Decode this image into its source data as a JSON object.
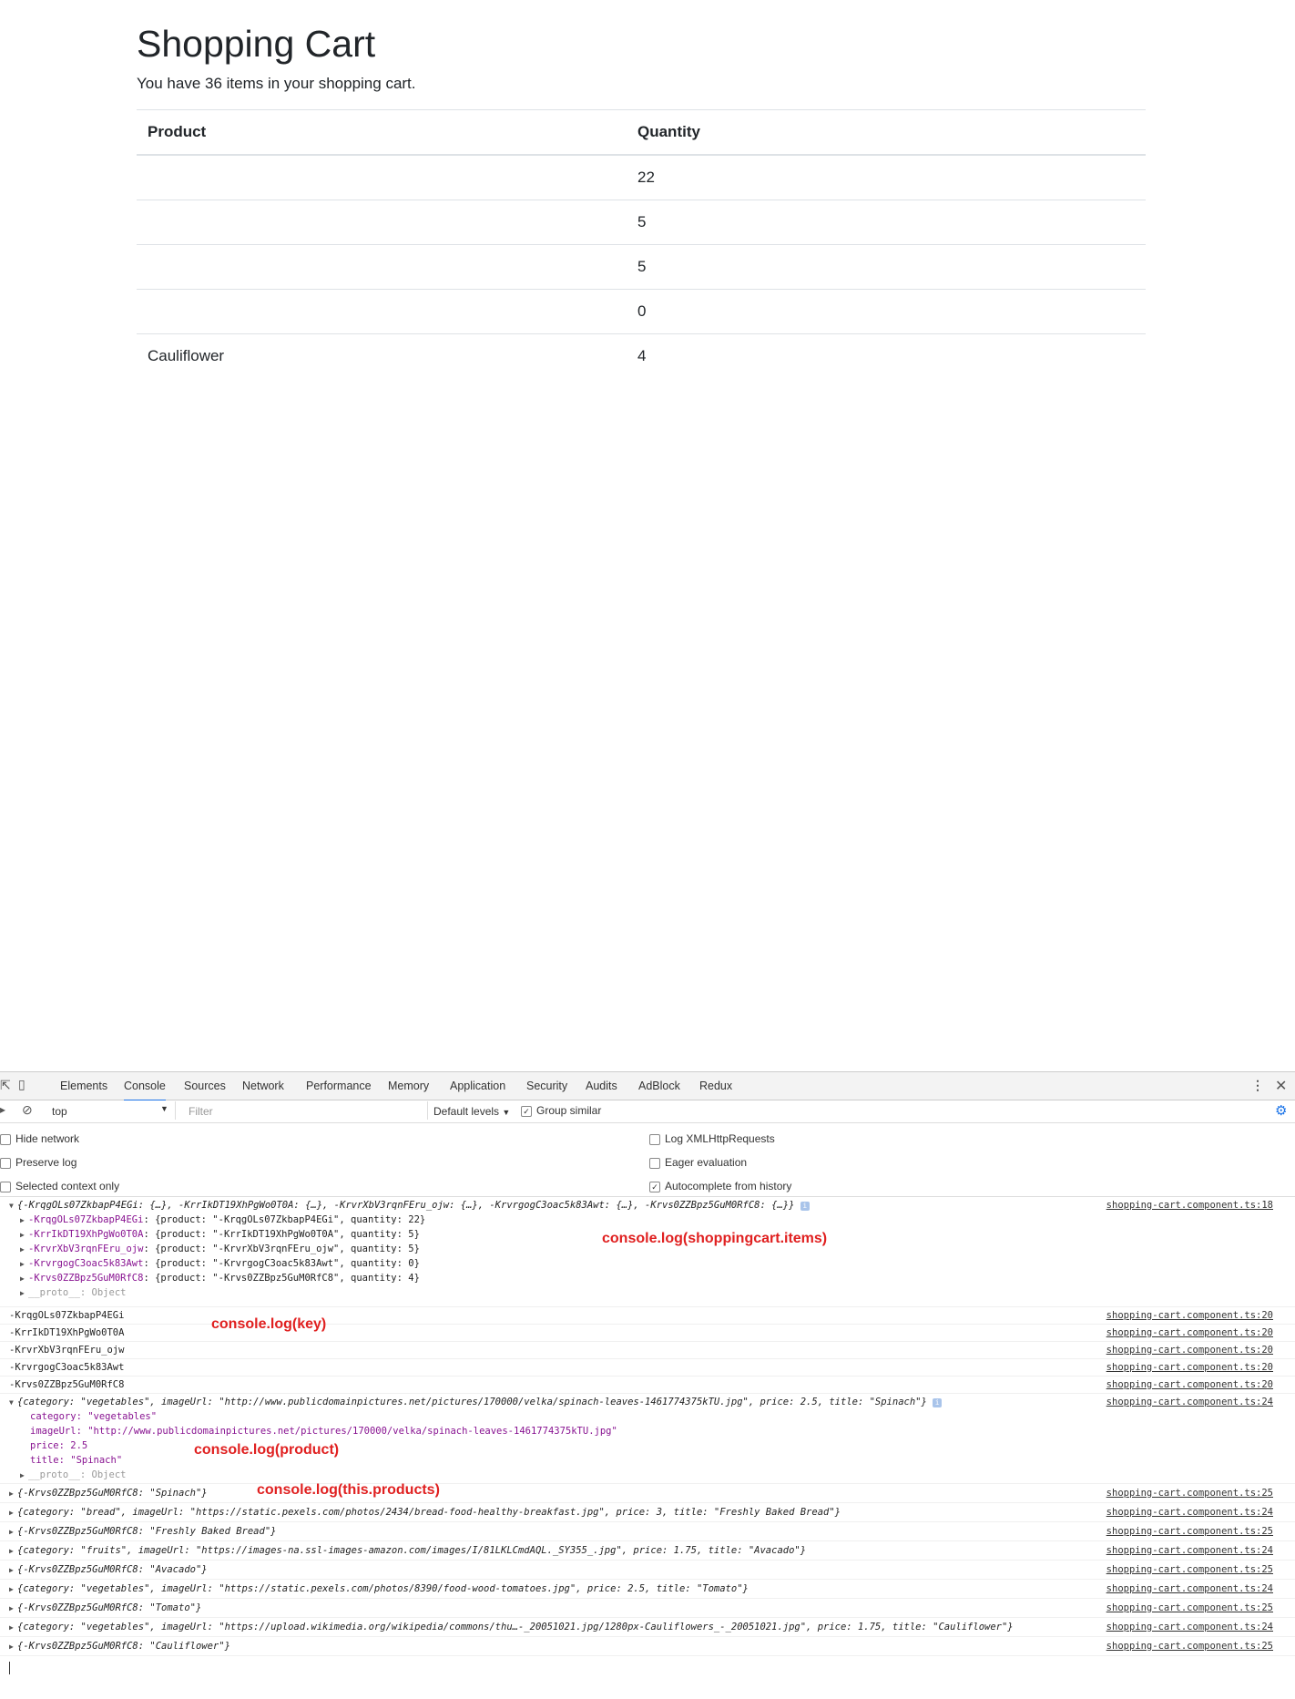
{
  "page": {
    "title": "Shopping Cart",
    "subtitle": "You have 36 items in your shopping cart.",
    "table": {
      "headers": [
        "Product",
        "Quantity"
      ],
      "rows": [
        {
          "product": "",
          "quantity": "22"
        },
        {
          "product": "",
          "quantity": "5"
        },
        {
          "product": "",
          "quantity": "5"
        },
        {
          "product": "",
          "quantity": "0"
        },
        {
          "product": "Cauliflower",
          "quantity": "4"
        }
      ]
    }
  },
  "devtools": {
    "tabs": [
      "Elements",
      "Console",
      "Sources",
      "Network",
      "Performance",
      "Memory",
      "Application",
      "Security",
      "Audits",
      "AdBlock",
      "Redux"
    ],
    "active_tab": "Console",
    "context": "top",
    "filter_placeholder": "Filter",
    "levels": "Default levels",
    "group_similar": "Group similar",
    "options_left": [
      "Hide network",
      "Preserve log",
      "Selected context only"
    ],
    "options_right": [
      "Log XMLHttpRequests",
      "Eager evaluation",
      "Autocomplete from history"
    ],
    "annotations": {
      "items": "console.log(shoppingcart.items)",
      "key": "console.log(key)",
      "product": "console.log(product)",
      "products": "console.log(this.products)"
    },
    "sources": {
      "l18": "shopping-cart.component.ts:18",
      "l20": "shopping-cart.component.ts:20",
      "l24": "shopping-cart.component.ts:24",
      "l25": "shopping-cart.component.ts:25"
    },
    "log": {
      "items_summary": "{-KrqgOLs07ZkbapP4EGi: {…}, -KrrIkDT19XhPgWo0T0A: {…}, -KrvrXbV3rqnFEru_ojw: {…}, -KrvrgogC3oac5k83Awt: {…}, -Krvs0ZZBpz5GuM0RfC8: {…}}",
      "items": [
        {
          "key": "-KrqgOLs07ZkbapP4EGi",
          "body": "{product: \"-KrqgOLs07ZkbapP4EGi\", quantity: 22}"
        },
        {
          "key": "-KrrIkDT19XhPgWo0T0A",
          "body": "{product: \"-KrrIkDT19XhPgWo0T0A\", quantity: 5}"
        },
        {
          "key": "-KrvrXbV3rqnFEru_ojw",
          "body": "{product: \"-KrvrXbV3rqnFEru_ojw\", quantity: 5}"
        },
        {
          "key": "-KrvrgogC3oac5k83Awt",
          "body": "{product: \"-KrvrgogC3oac5k83Awt\", quantity: 0}"
        },
        {
          "key": "-Krvs0ZZBpz5GuM0RfC8",
          "body": "{product: \"-Krvs0ZZBpz5GuM0RfC8\", quantity: 4}"
        }
      ],
      "proto": "__proto__: Object",
      "keys": [
        "-KrqgOLs07ZkbapP4EGi",
        "-KrrIkDT19XhPgWo0T0A",
        "-KrvrXbV3rqnFEru_ojw",
        "-KrvrgogC3oac5k83Awt",
        "-Krvs0ZZBpz5GuM0RfC8"
      ],
      "product_summary": "{category: \"vegetables\", imageUrl: \"http://www.publicdomainpictures.net/pictures/170000/velka/spinach-leaves-1461774375kTU.jpg\", price: 2.5, title: \"Spinach\"}",
      "product_fields": [
        "category: \"vegetables\"",
        "imageUrl: \"http://www.publicdomainpictures.net/pictures/170000/velka/spinach-leaves-1461774375kTU.jpg\"",
        "price: 2.5",
        "title: \"Spinach\""
      ],
      "rest": [
        {
          "text": "{-Krvs0ZZBpz5GuM0RfC8: \"Spinach\"}",
          "src": "shopping-cart.component.ts:25"
        },
        {
          "text": "{category: \"bread\", imageUrl: \"https://static.pexels.com/photos/2434/bread-food-healthy-breakfast.jpg\", price: 3, title: \"Freshly Baked Bread\"}",
          "src": "shopping-cart.component.ts:24"
        },
        {
          "text": "{-Krvs0ZZBpz5GuM0RfC8: \"Freshly Baked Bread\"}",
          "src": "shopping-cart.component.ts:25"
        },
        {
          "text": "{category: \"fruits\", imageUrl: \"https://images-na.ssl-images-amazon.com/images/I/81LKLCmdAQL._SY355_.jpg\", price: 1.75, title: \"Avacado\"}",
          "src": "shopping-cart.component.ts:24"
        },
        {
          "text": "{-Krvs0ZZBpz5GuM0RfC8: \"Avacado\"}",
          "src": "shopping-cart.component.ts:25"
        },
        {
          "text": "{category: \"vegetables\", imageUrl: \"https://static.pexels.com/photos/8390/food-wood-tomatoes.jpg\", price: 2.5, title: \"Tomato\"}",
          "src": "shopping-cart.component.ts:24"
        },
        {
          "text": "{-Krvs0ZZBpz5GuM0RfC8: \"Tomato\"}",
          "src": "shopping-cart.component.ts:25"
        },
        {
          "text": "{category: \"vegetables\", imageUrl: \"https://upload.wikimedia.org/wikipedia/commons/thu…-_20051021.jpg/1280px-Cauliflowers_-_20051021.jpg\", price: 1.75, title: \"Cauliflower\"}",
          "src": "shopping-cart.component.ts:24"
        },
        {
          "text": "{-Krvs0ZZBpz5GuM0RfC8: \"Cauliflower\"}",
          "src": "shopping-cart.component.ts:25"
        }
      ]
    }
  }
}
